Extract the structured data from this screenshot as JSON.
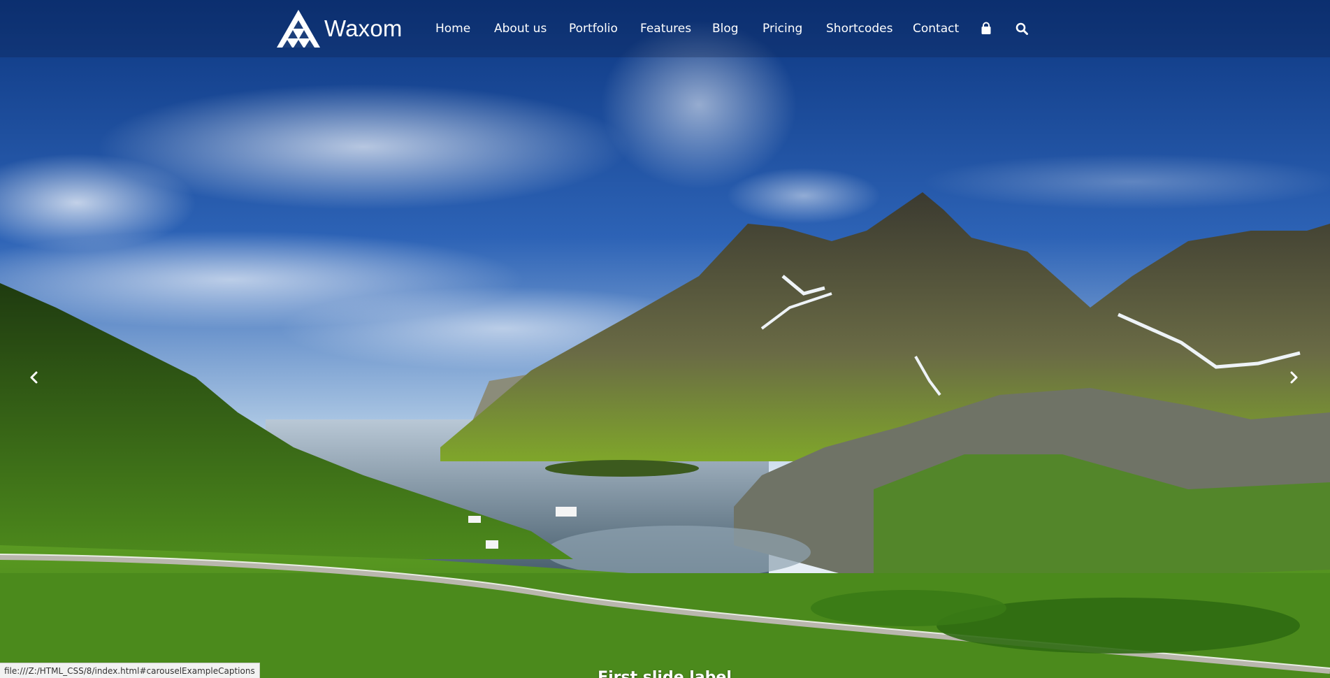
{
  "brand": {
    "name": "Waxom",
    "logo": "triangle-pyramid-logo"
  },
  "nav": {
    "items": [
      {
        "label": "Home"
      },
      {
        "label": "About us"
      },
      {
        "label": "Portfolio"
      },
      {
        "label": "Features"
      },
      {
        "label": "Blog"
      },
      {
        "label": "Pricing"
      },
      {
        "label": "Shortcodes"
      },
      {
        "label": "Contact"
      }
    ],
    "icons": [
      "shopping-bag-icon",
      "search-icon"
    ]
  },
  "carousel": {
    "caption": "First slide label",
    "controls": [
      "chevron-left-icon",
      "chevron-right-icon"
    ]
  },
  "status_bar": {
    "text": "file:///Z:/HTML_CSS/8/index.html#carouselExampleCaptions"
  },
  "colors": {
    "sky_top": "#0c3d8f",
    "sky_mid": "#3a74c8",
    "horizon": "#dfe8f2",
    "grass": "#4f8f1e",
    "mountain": "#4c4a3a",
    "water": "#7a95a8",
    "nav_text": "#ffffff"
  }
}
